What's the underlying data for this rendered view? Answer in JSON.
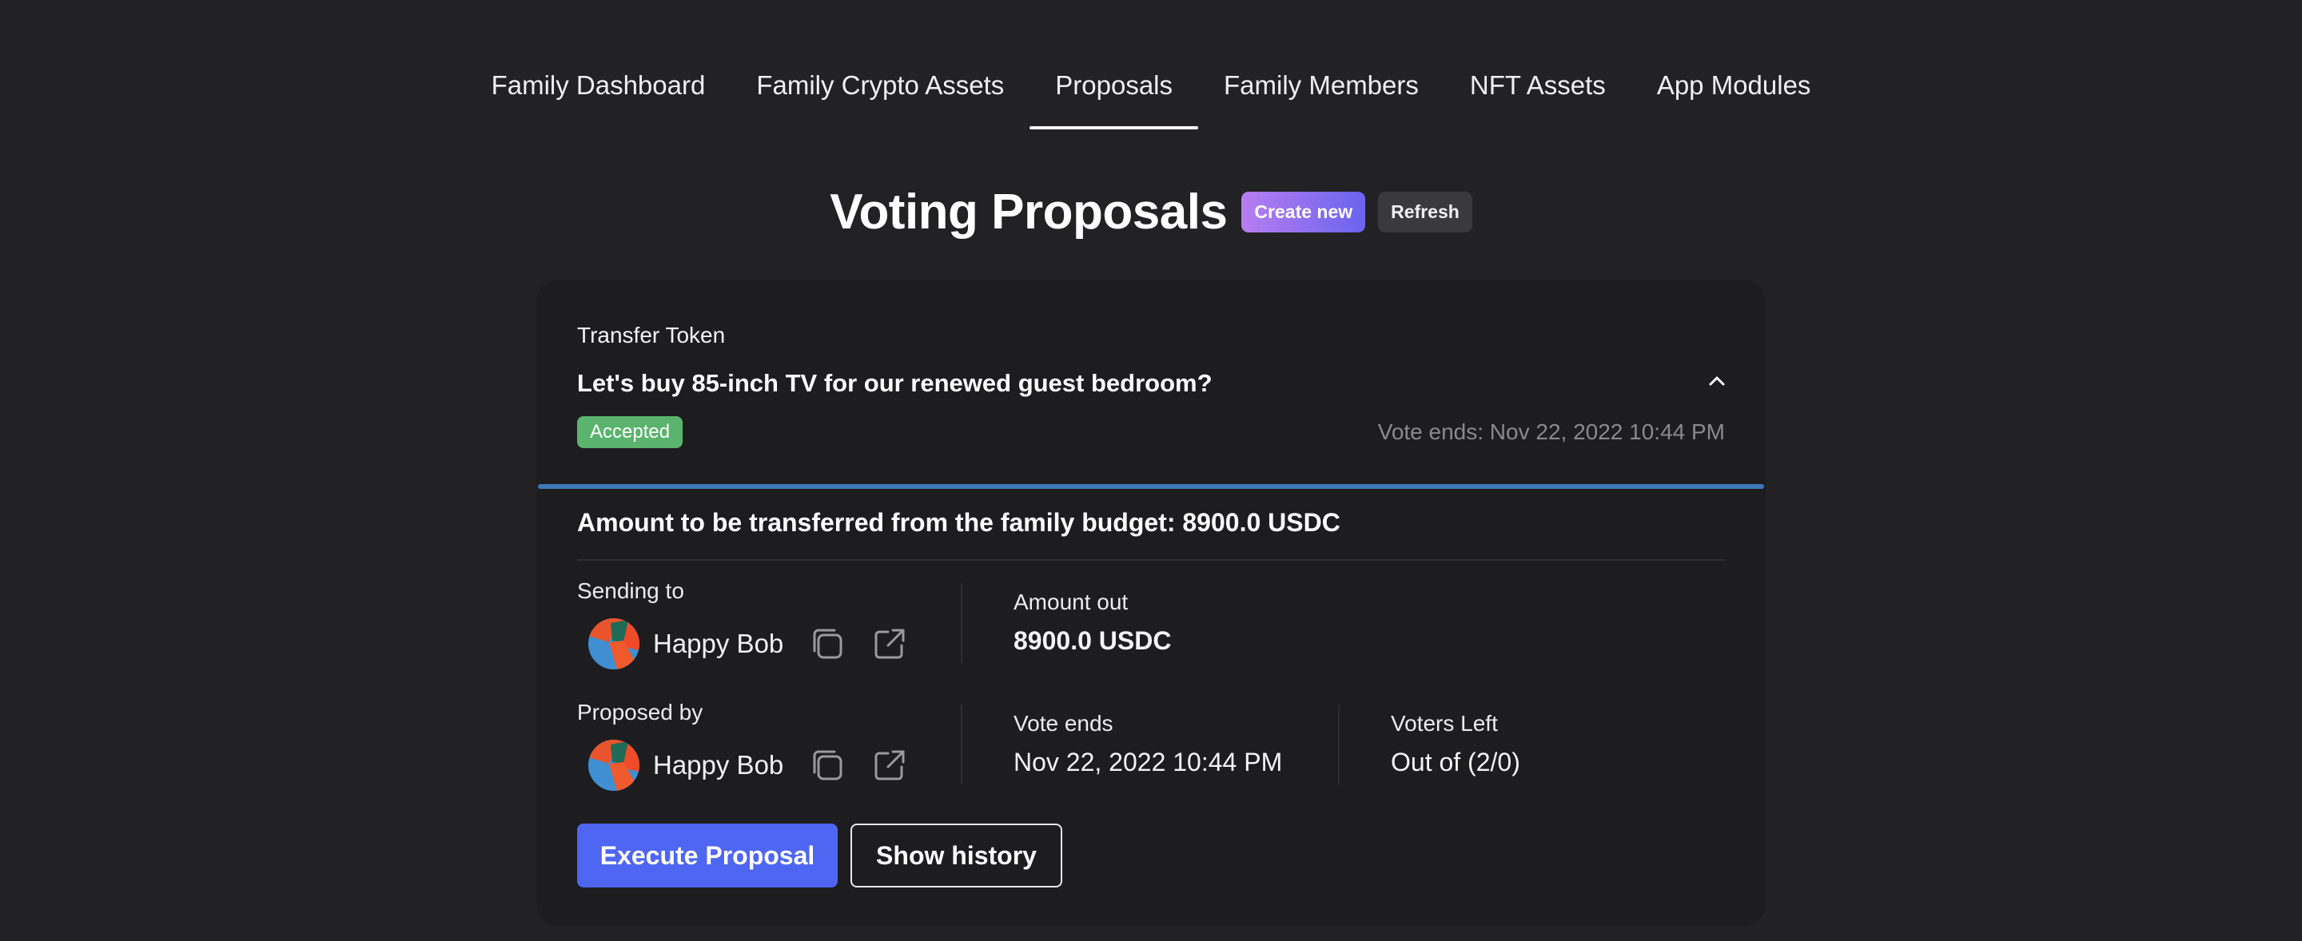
{
  "nav": {
    "items": [
      {
        "label": "Family Dashboard",
        "active": false
      },
      {
        "label": "Family Crypto Assets",
        "active": false
      },
      {
        "label": "Proposals",
        "active": true
      },
      {
        "label": "Family Members",
        "active": false
      },
      {
        "label": "NFT Assets",
        "active": false
      },
      {
        "label": "App Modules",
        "active": false
      }
    ]
  },
  "header": {
    "title": "Voting Proposals",
    "create_label": "Create new",
    "refresh_label": "Refresh"
  },
  "proposal": {
    "type": "Transfer Token",
    "title": "Let's buy 85-inch TV for our renewed guest bedroom?",
    "status": "Accepted",
    "vote_ends_header": "Vote ends: Nov 22, 2022 10:44 PM",
    "progress_fraction": 1.0,
    "amount_summary": "Amount to be transferred from the family budget: 8900.0 USDC",
    "sending_to": {
      "label": "Sending to",
      "name": "Happy Bob"
    },
    "amount_out": {
      "label": "Amount out",
      "value": "8900.0 USDC"
    },
    "proposed_by": {
      "label": "Proposed by",
      "name": "Happy Bob"
    },
    "vote_ends": {
      "label": "Vote ends",
      "value": "Nov 22, 2022 10:44 PM"
    },
    "voters_left": {
      "label": "Voters Left",
      "value": "Out of (2/0)"
    },
    "execute_label": "Execute Proposal",
    "history_label": "Show history"
  },
  "colors": {
    "background": "#222224",
    "card": "#1d1d1f",
    "accepted": "#5bb46d",
    "primary": "#4e66f2",
    "progress": "#3e77b9",
    "create_gradient_start": "#b77ef0",
    "create_gradient_end": "#6b63ee"
  },
  "icons": {
    "copy": "copy-icon",
    "external": "external-link-icon",
    "chevron": "chevron-up-icon"
  }
}
